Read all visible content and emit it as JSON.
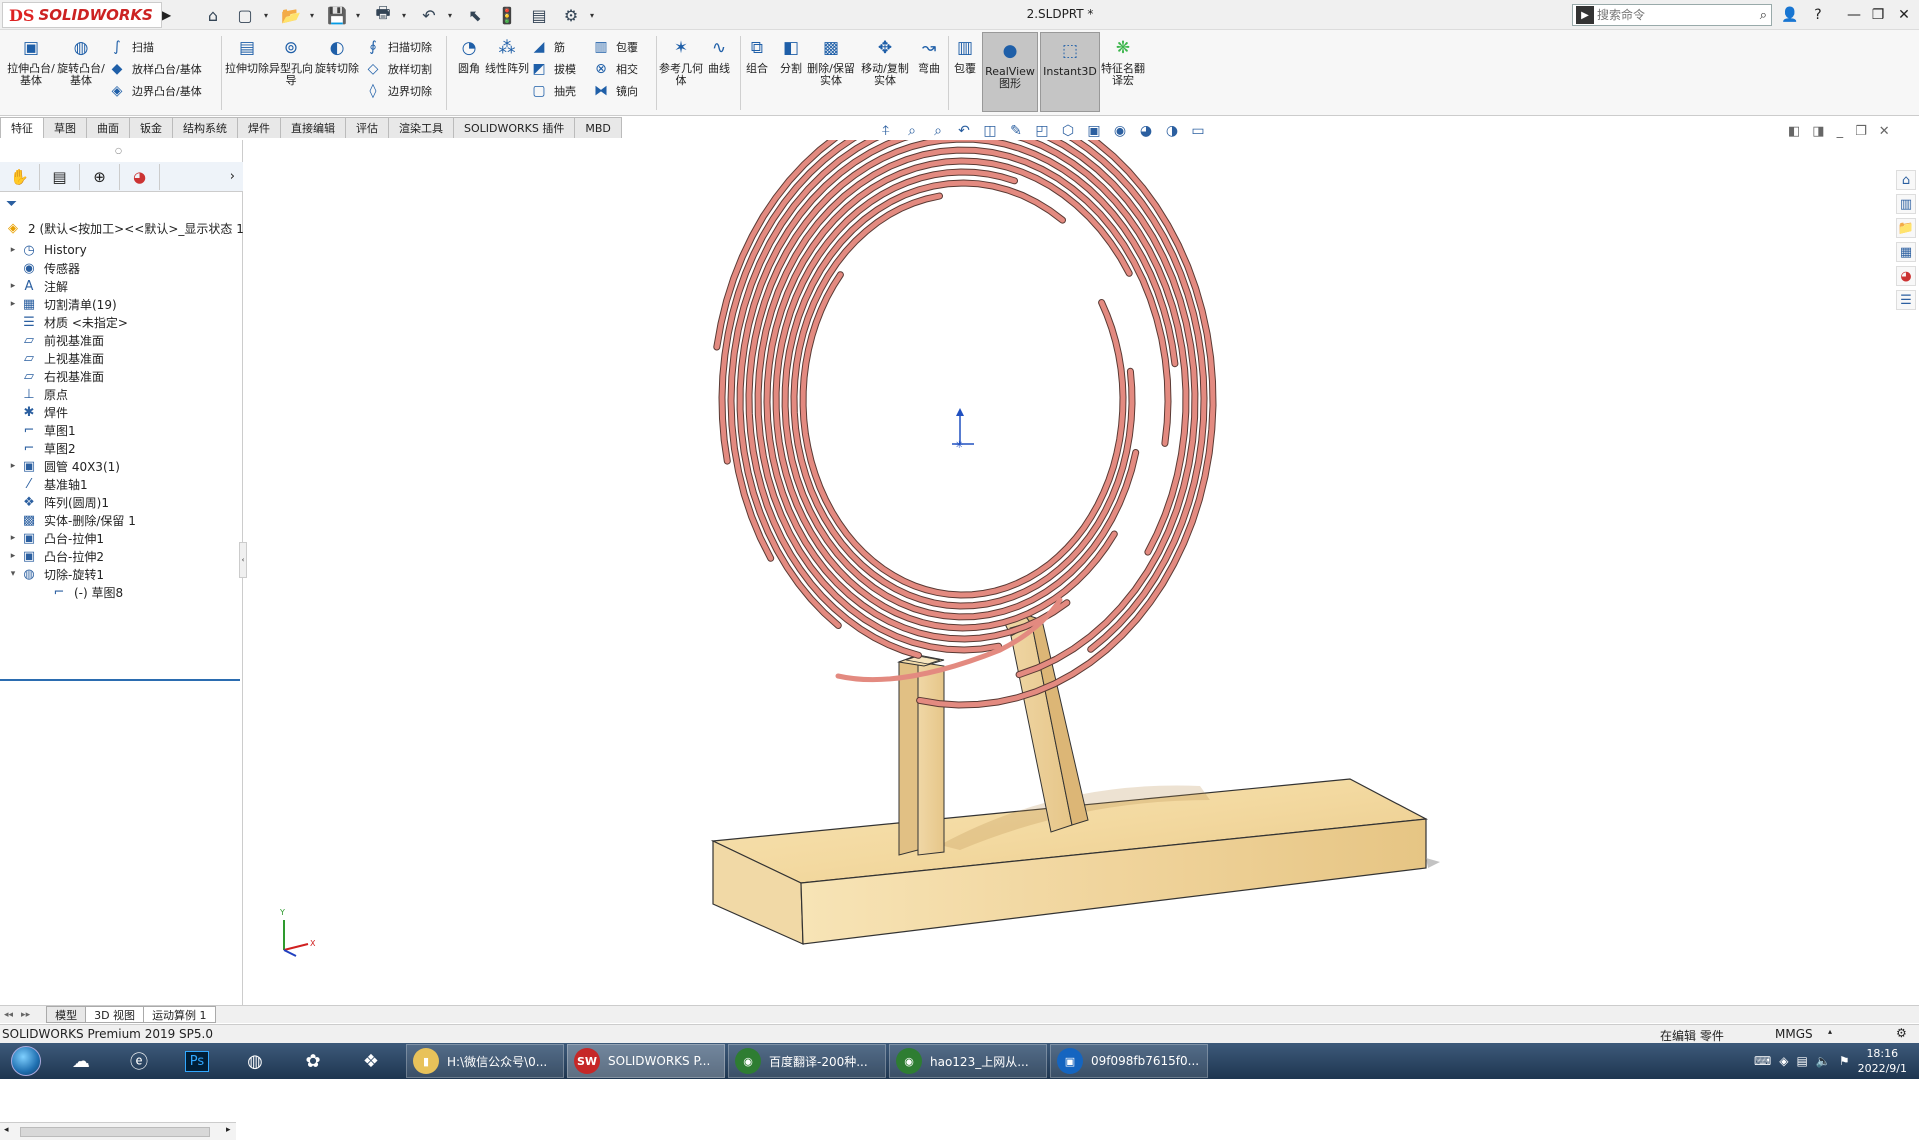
{
  "app": {
    "brand_ds": "DS",
    "brand_name": "SOLIDWORKS",
    "document_title": "2.SLDPRT *"
  },
  "quick_access": [
    {
      "name": "home-icon",
      "glyph": "⌂"
    },
    {
      "name": "new-file-icon",
      "glyph": "▢"
    },
    {
      "name": "open-file-icon",
      "glyph": "📂"
    },
    {
      "name": "save-icon",
      "glyph": "💾"
    },
    {
      "name": "print-icon",
      "glyph": "🖶"
    },
    {
      "name": "undo-icon",
      "glyph": "↶"
    },
    {
      "name": "select-icon",
      "glyph": "⬉"
    },
    {
      "name": "rebuild-icon",
      "glyph": "🚦"
    },
    {
      "name": "file-properties-icon",
      "glyph": "▤"
    },
    {
      "name": "options-icon",
      "glyph": "⚙"
    }
  ],
  "search": {
    "placeholder": "搜索命令"
  },
  "ribbon": {
    "extrude_boss": "拉伸凸台/基体",
    "revolve_boss": "旋转凸台/基体",
    "sweep": "扫描",
    "loft_boss": "放样凸台/基体",
    "boundary_boss": "边界凸台/基体",
    "extrude_cut": "拉伸切除",
    "hole_wizard": "异型孔向导",
    "revolve_cut": "旋转切除",
    "sweep_cut": "扫描切除",
    "loft_cut": "放样切割",
    "boundary_cut": "边界切除",
    "fillet": "圆角",
    "linear_pattern": "线性阵列",
    "rib": "筋",
    "draft": "拔模",
    "shell": "抽壳",
    "wrap": "包覆",
    "intersect": "相交",
    "mirror": "镜向",
    "ref_geometry": "参考几何体",
    "curves": "曲线",
    "combine": "组合",
    "split": "分割",
    "delete_body": "删除/保留实体",
    "move_copy": "移动/复制实体",
    "flex": "弯曲",
    "wrap2": "包覆",
    "realview": "RealView图形",
    "instant3d": "Instant3D",
    "feature_translate": "特征名翻译宏"
  },
  "tabs": [
    "特征",
    "草图",
    "曲面",
    "钣金",
    "结构系统",
    "焊件",
    "直接编辑",
    "评估",
    "渲染工具",
    "SOLIDWORKS 插件",
    "MBD"
  ],
  "tree": {
    "root": "2 (默认<按加工><<默认>_显示状态 1",
    "items": [
      {
        "label": "History",
        "icon": "history-icon",
        "glyph": "◷",
        "expand": true,
        "indent": 0
      },
      {
        "label": "传感器",
        "icon": "sensor-icon",
        "glyph": "◉",
        "expand": false,
        "indent": 0
      },
      {
        "label": "注解",
        "icon": "annotation-icon",
        "glyph": "A",
        "expand": true,
        "indent": 0
      },
      {
        "label": "切割清单(19)",
        "icon": "cut-list-icon",
        "glyph": "▦",
        "expand": true,
        "indent": 0
      },
      {
        "label": "材质 <未指定>",
        "icon": "material-icon",
        "glyph": "☰",
        "expand": false,
        "indent": 0
      },
      {
        "label": "前视基准面",
        "icon": "plane-icon",
        "glyph": "▱",
        "expand": false,
        "indent": 0
      },
      {
        "label": "上视基准面",
        "icon": "plane-icon",
        "glyph": "▱",
        "expand": false,
        "indent": 0
      },
      {
        "label": "右视基准面",
        "icon": "plane-icon",
        "glyph": "▱",
        "expand": false,
        "indent": 0
      },
      {
        "label": "原点",
        "icon": "origin-icon",
        "glyph": "⊥",
        "expand": false,
        "indent": 0
      },
      {
        "label": "焊件",
        "icon": "weldment-icon",
        "glyph": "✱",
        "expand": false,
        "indent": 0
      },
      {
        "label": "草图1",
        "icon": "sketch-icon",
        "glyph": "⌐",
        "expand": false,
        "indent": 0
      },
      {
        "label": "草图2",
        "icon": "sketch-icon",
        "glyph": "⌐",
        "expand": false,
        "indent": 0
      },
      {
        "label": "圆管 40X3(1)",
        "icon": "structural-member-icon",
        "glyph": "▣",
        "expand": true,
        "indent": 0
      },
      {
        "label": "基准轴1",
        "icon": "axis-icon",
        "glyph": "⁄",
        "expand": false,
        "indent": 0
      },
      {
        "label": "阵列(圆周)1",
        "icon": "circular-pattern-icon",
        "glyph": "❖",
        "expand": false,
        "indent": 0
      },
      {
        "label": "实体-删除/保留 1",
        "icon": "delete-body-icon",
        "glyph": "▩",
        "expand": false,
        "indent": 0
      },
      {
        "label": "凸台-拉伸1",
        "icon": "extrude-icon",
        "glyph": "▣",
        "expand": true,
        "indent": 0
      },
      {
        "label": "凸台-拉伸2",
        "icon": "extrude-icon",
        "glyph": "▣",
        "expand": true,
        "indent": 0
      },
      {
        "label": "切除-旋转1",
        "icon": "revolve-cut-icon",
        "glyph": "◍",
        "expand": true,
        "indent": 0,
        "open": true
      },
      {
        "label": "(-) 草图8",
        "icon": "sketch-icon",
        "glyph": "⌐",
        "expand": false,
        "indent": 1
      }
    ]
  },
  "bottom_tabs": [
    "模型",
    "3D 视图",
    "运动算例 1"
  ],
  "status": {
    "product": "SOLIDWORKS Premium 2019 SP5.0",
    "mode": "在编辑 零件",
    "units": "MMGS"
  },
  "taskbar": {
    "apps": [
      {
        "label": "H:\\微信公众号\\0...",
        "color": "#e8c25a",
        "icon": "folder-icon",
        "glyph": "▮"
      },
      {
        "label": "SOLIDWORKS P...",
        "color": "#c62828",
        "icon": "solidworks-icon",
        "glyph": "SW"
      },
      {
        "label": "百度翻译-200种...",
        "color": "#2e7d32",
        "icon": "chrome-icon",
        "glyph": "◉"
      },
      {
        "label": "hao123_上网从...",
        "color": "#2e7d32",
        "icon": "chrome-icon",
        "glyph": "◉"
      },
      {
        "label": "09f098fb7615f0...",
        "color": "#1565c0",
        "icon": "image-viewer-icon",
        "glyph": "▣"
      }
    ],
    "time": "18:16",
    "date": "2022/9/1"
  },
  "colors": {
    "ribbon_bg": "#f7f7f7",
    "coil": "#e38a80",
    "wood": "#f2dba5"
  }
}
